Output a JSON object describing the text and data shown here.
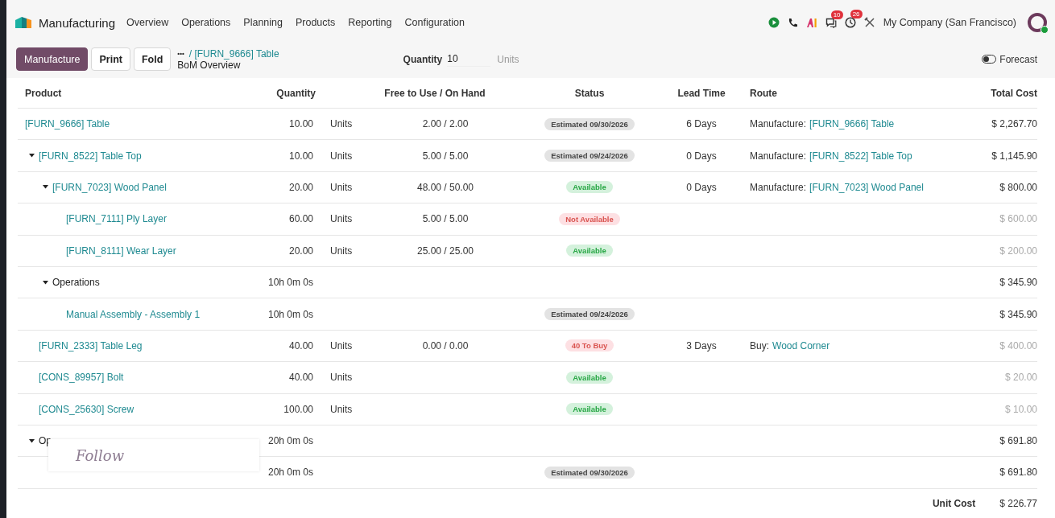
{
  "app": {
    "name": "Manufacturing"
  },
  "menu": [
    {
      "label": "Overview"
    },
    {
      "label": "Operations"
    },
    {
      "label": "Planning"
    },
    {
      "label": "Products"
    },
    {
      "label": "Reporting"
    },
    {
      "label": "Configuration"
    }
  ],
  "systray": {
    "messages_badge": "10",
    "activities_badge": "26",
    "company": "My Company (San Francisco)"
  },
  "toolbar": {
    "buttons": [
      {
        "label": "Manufacture",
        "kind": "primary"
      },
      {
        "label": "Print",
        "kind": "secondary"
      },
      {
        "label": "Fold",
        "kind": "secondary"
      }
    ],
    "breadcrumb": {
      "ellipsis": "•••",
      "parent": "/ [FURN_9666] Table",
      "current": "BoM Overview"
    },
    "quantity": {
      "label": "Quantity",
      "value": "10",
      "unit": "Units"
    },
    "forecast": {
      "label": "Forecast",
      "on": false
    }
  },
  "table": {
    "columns": [
      "Product",
      "Quantity",
      "Free to Use / On Hand",
      "Status",
      "Lead Time",
      "Route",
      "Total Cost"
    ],
    "rows": [
      {
        "name": "[FURN_9666] Table",
        "link": true,
        "quantity": "10.00",
        "uom": "Units",
        "free": "2.00 / 2.00",
        "status": {
          "label": "Estimated 09/30/2026",
          "kind": "estimated"
        },
        "lead": "6 Days",
        "route": {
          "prefix": "Manufacture:",
          "link": "[FURN_9666] Table"
        },
        "cost": "$ 2,267.70",
        "muted": false,
        "children": [
          {
            "name": "[FURN_8522] Table Top",
            "link": true,
            "quantity": "10.00",
            "uom": "Units",
            "free": "5.00 / 5.00",
            "status": {
              "label": "Estimated 09/24/2026",
              "kind": "estimated"
            },
            "lead": "0 Days",
            "route": {
              "prefix": "Manufacture:",
              "link": "[FURN_8522] Table Top"
            },
            "cost": "$ 1,145.90",
            "muted": false,
            "expanded": true,
            "children": [
              {
                "name": "[FURN_7023] Wood Panel",
                "link": true,
                "quantity": "20.00",
                "uom": "Units",
                "free": "48.00 / 50.00",
                "status": {
                  "label": "Available",
                  "kind": "available"
                },
                "lead": "0 Days",
                "route": {
                  "prefix": "Manufacture:",
                  "link": "[FURN_7023] Wood Panel"
                },
                "cost": "$ 800.00",
                "muted": false,
                "expanded": true,
                "children": [
                  {
                    "name": "[FURN_7111] Ply Layer",
                    "link": true,
                    "quantity": "60.00",
                    "uom": "Units",
                    "free": "5.00 / 5.00",
                    "status": {
                      "label": "Not Available",
                      "kind": "unavailable"
                    },
                    "cost": "$ 600.00",
                    "muted": true
                  },
                  {
                    "name": "[FURN_8111] Wear Layer",
                    "link": true,
                    "quantity": "20.00",
                    "uom": "Units",
                    "free": "25.00 / 25.00",
                    "status": {
                      "label": "Available",
                      "kind": "available"
                    },
                    "cost": "$ 200.00",
                    "muted": true
                  }
                ]
              },
              {
                "name": "Operations",
                "link": false,
                "quantity": "10h 0m 0s",
                "cost": "$ 345.90",
                "muted": false,
                "expanded": true,
                "children": [
                  {
                    "name": "Manual Assembly - Assembly 1",
                    "link": true,
                    "quantity": "10h 0m 0s",
                    "status": {
                      "label": "Estimated 09/24/2026",
                      "kind": "estimated"
                    },
                    "cost": "$ 345.90",
                    "muted": false
                  }
                ]
              }
            ]
          },
          {
            "name": "[FURN_2333] Table Leg",
            "link": true,
            "quantity": "40.00",
            "uom": "Units",
            "free": "0.00 / 0.00",
            "status": {
              "label": "40 To Buy",
              "kind": "tobuy"
            },
            "lead": "3 Days",
            "route": {
              "prefix": "Buy:",
              "link": "Wood Corner"
            },
            "cost": "$ 400.00",
            "muted": true
          },
          {
            "name": "[CONS_89957] Bolt",
            "link": true,
            "quantity": "40.00",
            "uom": "Units",
            "status": {
              "label": "Available",
              "kind": "available"
            },
            "cost": "$ 20.00",
            "muted": true
          },
          {
            "name": "[CONS_25630] Screw",
            "link": true,
            "quantity": "100.00",
            "uom": "Units",
            "status": {
              "label": "Available",
              "kind": "available"
            },
            "cost": "$ 10.00",
            "muted": true
          },
          {
            "name": "Op",
            "link": false,
            "quantity": "20h 0m 0s",
            "cost": "$ 691.80",
            "muted": false,
            "expanded": true,
            "children": [
              {
                "quantity": "20h 0m 0s",
                "status": {
                  "label": "Estimated 09/30/2026",
                  "kind": "estimated"
                },
                "cost": "$ 691.80",
                "muted": false
              }
            ]
          }
        ]
      }
    ],
    "footer": {
      "label": "Unit Cost",
      "value": "$ 226.77"
    }
  },
  "overlay": {
    "text": "Follow"
  }
}
